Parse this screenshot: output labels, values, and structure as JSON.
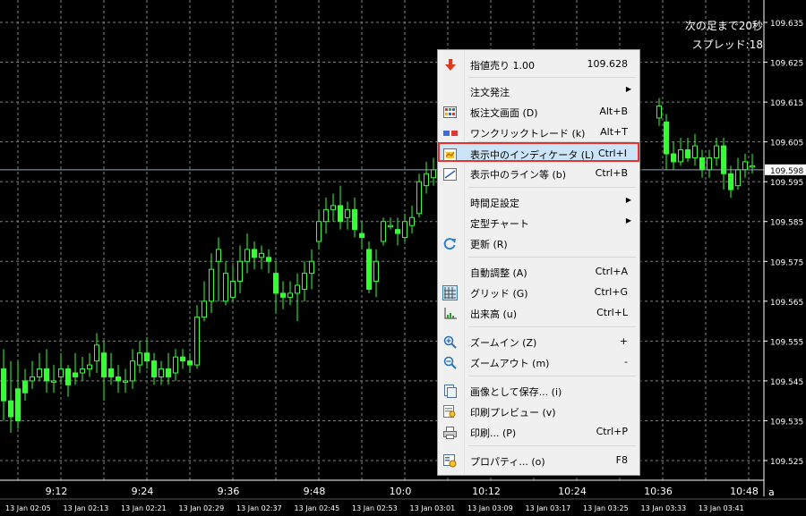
{
  "overlay": {
    "countdown": "次の足まで20秒",
    "spread": "スプレッド:18"
  },
  "price_axis": {
    "labels": [
      "109.635",
      "109.625",
      "109.615",
      "109.605",
      "109.595",
      "109.585",
      "109.575",
      "109.565",
      "109.555",
      "109.545",
      "109.535",
      "109.525"
    ],
    "current_price": "109.598"
  },
  "time_axis": {
    "major_labels": [
      "9:12",
      "9:24",
      "9:36",
      "9:48",
      "10:0",
      "10:12",
      "10:24",
      "10:36",
      "10:48"
    ],
    "minor_labels": [
      "13 Jan 02:05",
      "13 Jan 02:13",
      "13 Jan 02:21",
      "13 Jan 02:29",
      "13 Jan 02:37",
      "13 Jan 02:45",
      "13 Jan 02:53",
      "13 Jan 03:01",
      "13 Jan 03:09",
      "13 Jan 03:17",
      "13 Jan 03:25",
      "13 Jan 03:33",
      "13 Jan 03:41"
    ],
    "scroll_marker": "a"
  },
  "colors": {
    "background": "#000000",
    "grid": "#7f7f7f",
    "candle": "#33ff33",
    "bid_line": "#8fa8c4",
    "menu_highlight_border": "#e8312a",
    "menu_highlight_fill": "#cce4f7"
  },
  "menu": {
    "items": [
      {
        "label": "指値売り 1.00",
        "shortcut": "109.628",
        "icon": "sell-arrow-icon"
      },
      {
        "label": "注文発注",
        "submenu": true
      },
      {
        "label": "板注文画面 (D)",
        "shortcut": "Alt+B",
        "icon": "order-board-icon"
      },
      {
        "label": "ワンクリックトレード (k)",
        "shortcut": "Alt+T",
        "icon": "one-click-trade-icon"
      },
      {
        "label": "表示中のインディケータ (L)",
        "shortcut": "Ctrl+I",
        "icon": "indicator-list-icon",
        "highlighted": true
      },
      {
        "label": "表示中のライン等 (b)",
        "shortcut": "Ctrl+B",
        "icon": "line-objects-icon"
      },
      {
        "label": "時間足設定",
        "submenu": true
      },
      {
        "label": "定型チャート",
        "submenu": true
      },
      {
        "label": "更新 (R)",
        "icon": "refresh-icon"
      },
      {
        "label": "自動調整 (A)",
        "shortcut": "Ctrl+A"
      },
      {
        "label": "グリッド (G)",
        "shortcut": "Ctrl+G",
        "icon": "grid-icon",
        "checked": true
      },
      {
        "label": "出来高 (u)",
        "shortcut": "Ctrl+L",
        "icon": "volume-icon"
      },
      {
        "label": "ズームイン (Z)",
        "shortcut": "+",
        "icon": "zoom-in-icon"
      },
      {
        "label": "ズームアウト (m)",
        "shortcut": "-",
        "icon": "zoom-out-icon"
      },
      {
        "label": "画像として保存... (i)",
        "icon": "save-image-icon"
      },
      {
        "label": "印刷プレビュー (v)",
        "icon": "print-preview-icon"
      },
      {
        "label": "印刷... (P)",
        "shortcut": "Ctrl+P",
        "icon": "printer-icon"
      },
      {
        "label": "プロパティ... (o)",
        "shortcut": "F8",
        "icon": "properties-icon"
      }
    ]
  }
}
